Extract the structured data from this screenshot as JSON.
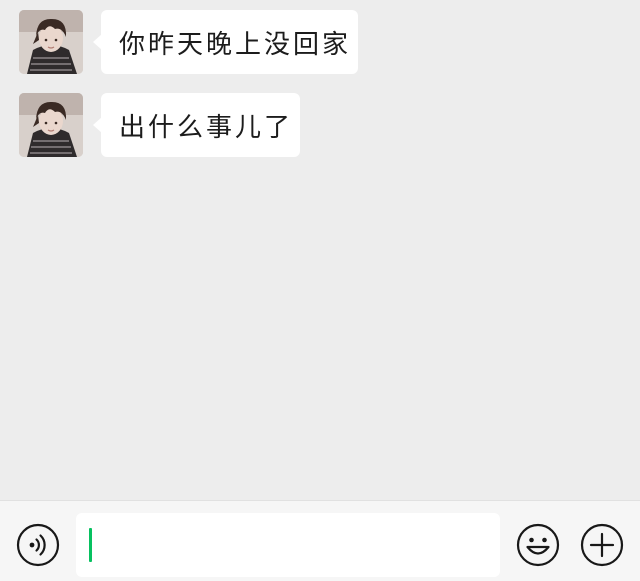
{
  "chat": {
    "messages": [
      {
        "sender": "other",
        "avatar_icon": "contact-avatar",
        "text": "你昨天晚上没回家"
      },
      {
        "sender": "other",
        "avatar_icon": "contact-avatar",
        "text": "出什么事儿了"
      }
    ]
  },
  "input_bar": {
    "voice_icon": "voice-icon",
    "message_value": "",
    "emoji_icon": "emoji-icon",
    "more_icon": "plus-circle-icon",
    "caret_color": "#07c160"
  },
  "colors": {
    "background": "#ededed",
    "bubble": "#ffffff",
    "input_bar": "#f6f6f6",
    "accent": "#07c160"
  }
}
